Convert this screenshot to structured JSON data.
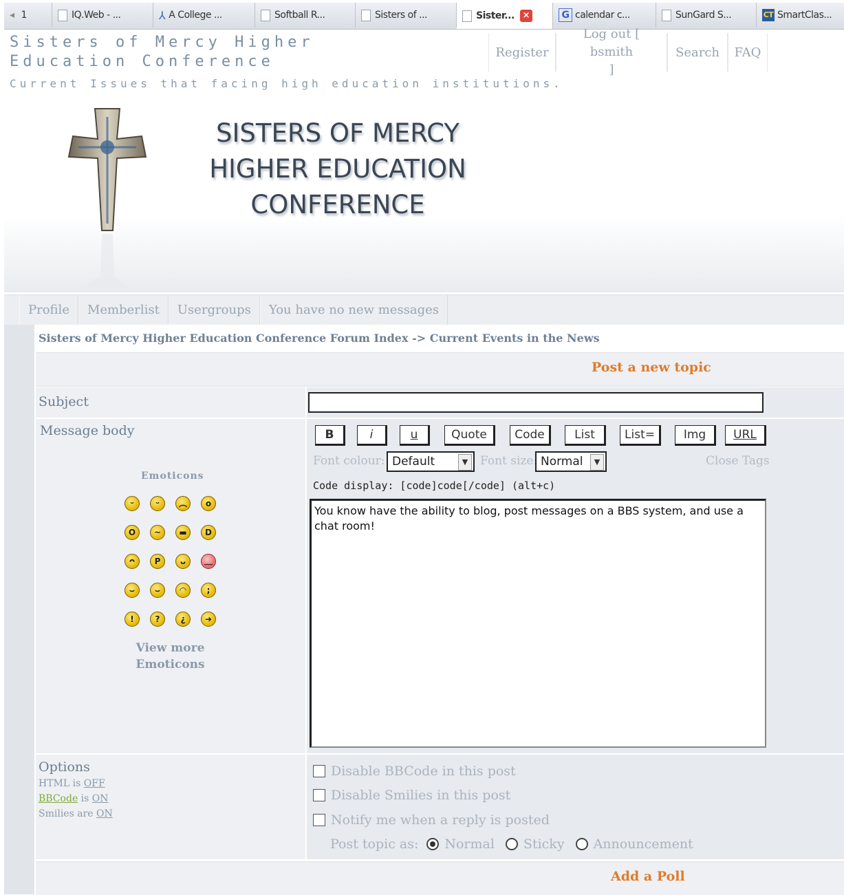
{
  "browser": {
    "tabs": [
      {
        "label": "1",
        "kind": "nav",
        "active": false
      },
      {
        "label": "IQ.Web - ...",
        "kind": "page",
        "active": false
      },
      {
        "label": "A College ...",
        "kind": "college",
        "active": false
      },
      {
        "label": "Softball R...",
        "kind": "page",
        "active": false
      },
      {
        "label": "Sisters of ...",
        "kind": "page",
        "active": false
      },
      {
        "label": "Sister...",
        "kind": "page",
        "active": true
      },
      {
        "label": "calendar c...",
        "kind": "google",
        "active": false
      },
      {
        "label": "SunGard S...",
        "kind": "page",
        "active": false
      },
      {
        "label": "SmartClas...",
        "kind": "smart",
        "active": false
      }
    ]
  },
  "header": {
    "site_title": "Sisters of Mercy Higher Education Conference",
    "tagline": "Current Issues that facing high education institutions.",
    "nav": {
      "register": "Register",
      "logout_line1": "Log out [ bsmith",
      "logout_line2": "]",
      "search": "Search",
      "faq": "FAQ"
    }
  },
  "banner": {
    "line1": "SISTERS OF MERCY",
    "line2": "HIGHER EDUCATION",
    "line3": "CONFERENCE"
  },
  "subnav": {
    "profile": "Profile",
    "memberlist": "Memberlist",
    "usergroups": "Usergroups",
    "messages": "You have no new messages"
  },
  "breadcrumb": "Sisters of Mercy Higher Education Conference Forum Index -> Current Events in the News",
  "form": {
    "title": "Post a new topic",
    "subject_label": "Subject",
    "subject_value": "",
    "message_label": "Message body",
    "bbcode_buttons": {
      "bold": "B",
      "italic": "i",
      "underline": "u",
      "quote": "Quote",
      "code": "Code",
      "list": "List",
      "list_eq": "List=",
      "img": "Img",
      "url": "URL"
    },
    "font_colour_label": "Font colour:",
    "font_colour_value": "Default",
    "font_size_label": "Font size:",
    "font_size_value": "Normal",
    "close_tags": "Close Tags",
    "code_display": "Code display: [code]code[/code]  (alt+c)",
    "message_value": "You know have the ability to blog, post messages on a BBS system, and use a chat room!",
    "emoticons_title": "Emoticons",
    "view_more_line1": "View more",
    "view_more_line2": "Emoticons",
    "emoticons": [
      {
        "name": "very-happy-emoticon",
        "glyph": "ᵕ"
      },
      {
        "name": "smile-emoticon",
        "glyph": "ᵕ"
      },
      {
        "name": "sad-emoticon",
        "glyph": "︵"
      },
      {
        "name": "surprised-emoticon",
        "glyph": "o"
      },
      {
        "name": "shocked-emoticon",
        "glyph": "O"
      },
      {
        "name": "confused-emoticon",
        "glyph": "~"
      },
      {
        "name": "cool-emoticon",
        "glyph": "▬"
      },
      {
        "name": "laughing-emoticon",
        "glyph": "D"
      },
      {
        "name": "mad-emoticon",
        "glyph": "ᴖ"
      },
      {
        "name": "razz-emoticon",
        "glyph": "P"
      },
      {
        "name": "embarassed-emoticon",
        "glyph": "ᴗ"
      },
      {
        "name": "crying-emoticon",
        "glyph": "﹏"
      },
      {
        "name": "evil-emoticon",
        "glyph": "⌣"
      },
      {
        "name": "twisted-evil-emoticon",
        "glyph": "⌣"
      },
      {
        "name": "rolling-eyes-emoticon",
        "glyph": "◠"
      },
      {
        "name": "wink-emoticon",
        "glyph": ";"
      },
      {
        "name": "exclamation-emoticon",
        "glyph": "!"
      },
      {
        "name": "question-emoticon",
        "glyph": "?"
      },
      {
        "name": "idea-emoticon",
        "glyph": "¿"
      },
      {
        "name": "arrow-emoticon",
        "glyph": "➜"
      }
    ],
    "options_label": "Options",
    "html_status_prefix": "HTML is ",
    "html_status_value": "OFF",
    "bbcode_link": "BBCode",
    "bbcode_status_mid": " is ",
    "bbcode_status_value": "ON",
    "smilies_status_prefix": "Smilies are ",
    "smilies_status_value": "ON",
    "disable_bbcode": "Disable BBCode in this post",
    "disable_smilies": "Disable Smilies in this post",
    "notify": "Notify me when a reply is posted",
    "post_topic_as": "Post topic as:",
    "type_normal": "Normal",
    "type_sticky": "Sticky",
    "type_announcement": "Announcement",
    "selected_type": "Normal",
    "add_poll": "Add a Poll"
  },
  "colors": {
    "accent_orange": "#e07b2a",
    "muted_text": "#98a4b2",
    "link_green": "#7fa83a"
  }
}
